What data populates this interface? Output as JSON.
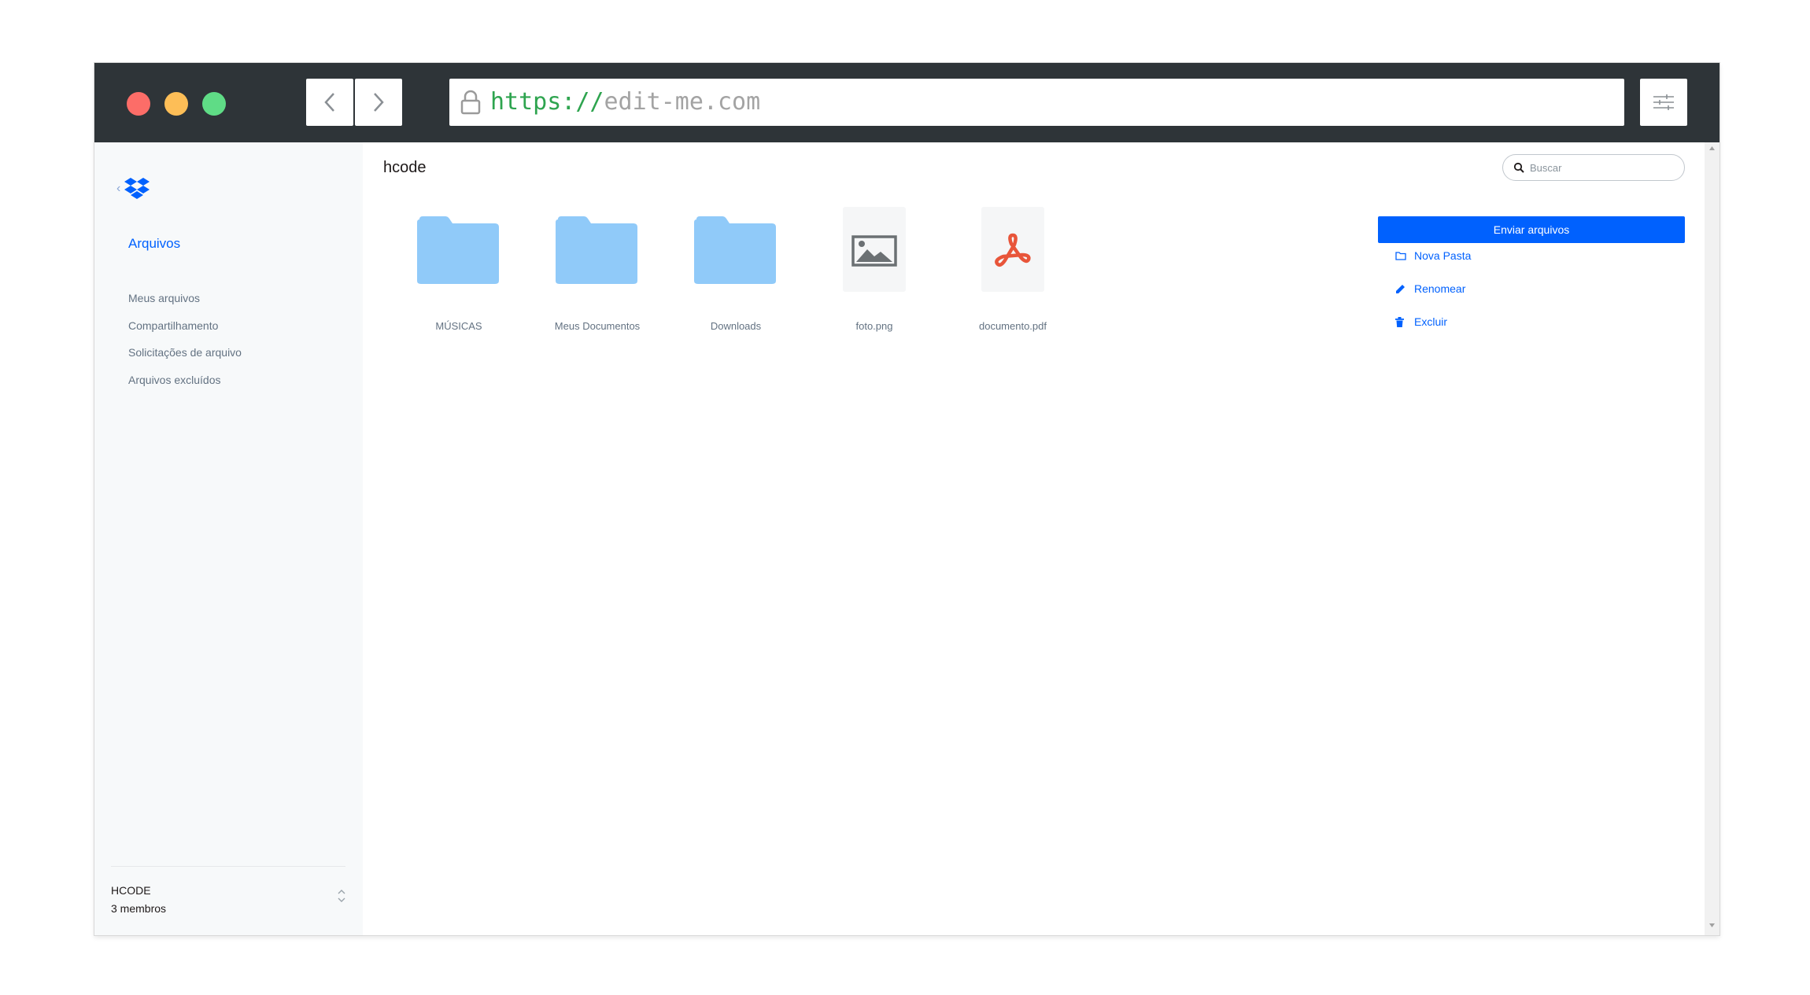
{
  "browser": {
    "url_scheme": "https://",
    "url_host": "edit-me.com"
  },
  "sidebar": {
    "section_title": "Arquivos",
    "items": [
      {
        "label": "Meus arquivos"
      },
      {
        "label": "Compartilhamento"
      },
      {
        "label": "Solicitações de arquivo"
      },
      {
        "label": "Arquivos excluídos"
      }
    ],
    "team": {
      "name": "HCODE",
      "members": "3 membros"
    }
  },
  "main": {
    "breadcrumb": "hcode",
    "search": {
      "placeholder": "Buscar"
    },
    "files": [
      {
        "name": "MÚSICAS",
        "icon": "folder-icon"
      },
      {
        "name": "Meus Documentos",
        "icon": "folder-icon"
      },
      {
        "name": "Downloads",
        "icon": "folder-icon"
      },
      {
        "name": "foto.png",
        "icon": "image-file-icon"
      },
      {
        "name": "documento.pdf",
        "icon": "pdf-file-icon"
      }
    ],
    "actions": {
      "upload_label": "Enviar arquivos",
      "new_folder_label": "Nova Pasta",
      "rename_label": "Renomear",
      "delete_label": "Excluir"
    }
  },
  "colors": {
    "accent": "#0061fe",
    "folder": "#90caf9",
    "pdf": "#e8553a",
    "titlebar": "#2e3438",
    "url_scheme": "#2ea44f"
  }
}
